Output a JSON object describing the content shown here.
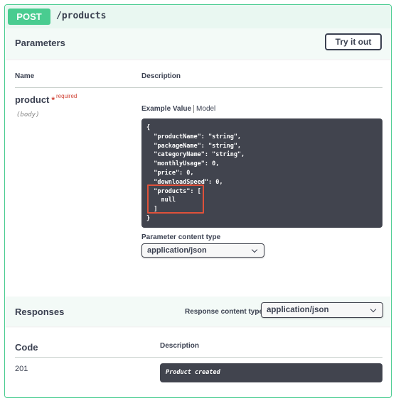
{
  "operation": {
    "method": "POST",
    "path": "/products"
  },
  "parameters": {
    "title": "Parameters",
    "try_button": "Try it out",
    "col_name": "Name",
    "col_description": "Description",
    "param": {
      "name": "product",
      "star": "*",
      "required": "required",
      "in": "(body)"
    },
    "tabs": {
      "example": "Example Value",
      "model": "Model"
    },
    "example_lines": [
      "{",
      "  \"productName\": \"string\",",
      "  \"packageName\": \"string\",",
      "  \"categoryName\": \"string\",",
      "  \"monthlyUsage\": 0,",
      "  \"price\": 0,",
      "  \"downloadSpeed\": 0,",
      "  \"products\": [",
      "    null",
      "  ]",
      "}"
    ],
    "content_type_label": "Parameter content type",
    "content_type_value": "application/json"
  },
  "responses": {
    "title": "Responses",
    "content_type_label": "Response content type",
    "content_type_value": "application/json",
    "col_code": "Code",
    "col_description": "Description",
    "rows": [
      {
        "code": "201",
        "description": "Product created"
      }
    ]
  },
  "colors": {
    "post": "#49cc90",
    "code_bg": "#41444e",
    "highlight": "#e0513a",
    "required": "#d04437"
  }
}
